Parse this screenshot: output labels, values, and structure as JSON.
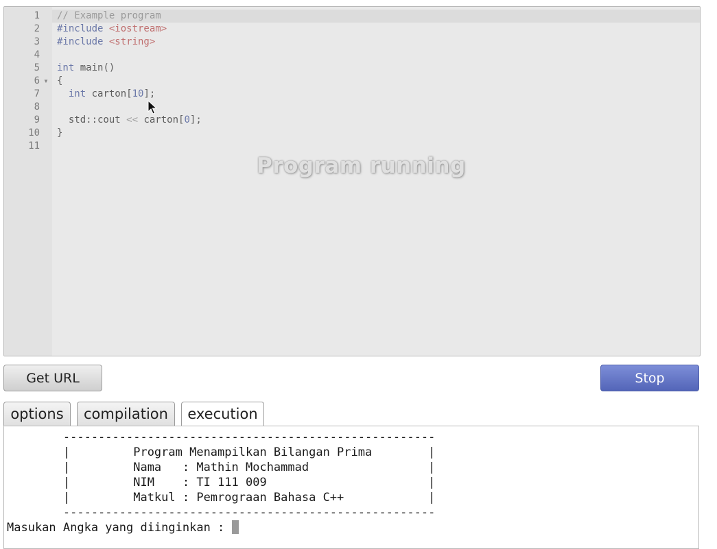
{
  "editor": {
    "line_numbers": [
      "1",
      "2",
      "3",
      "4",
      "5",
      "6",
      "7",
      "8",
      "9",
      "10",
      "11"
    ],
    "lines": [
      [
        {
          "t": "// Example program",
          "c": "comment"
        }
      ],
      [
        {
          "t": "#include ",
          "c": "meta"
        },
        {
          "t": "<iostream>",
          "c": "string"
        }
      ],
      [
        {
          "t": "#include ",
          "c": "meta"
        },
        {
          "t": "<string>",
          "c": "string"
        }
      ],
      [],
      [
        {
          "t": "int",
          "c": "keyword"
        },
        {
          "t": " main()",
          "c": "plain"
        }
      ],
      [
        {
          "t": "{",
          "c": "plain"
        }
      ],
      [
        {
          "t": "  ",
          "c": "plain"
        },
        {
          "t": "int",
          "c": "keyword"
        },
        {
          "t": " carton[",
          "c": "plain"
        },
        {
          "t": "10",
          "c": "number"
        },
        {
          "t": "];",
          "c": "plain"
        }
      ],
      [],
      [
        {
          "t": "  std::cout ",
          "c": "plain"
        },
        {
          "t": "<<",
          "c": "op"
        },
        {
          "t": " carton[",
          "c": "plain"
        },
        {
          "t": "0",
          "c": "number"
        },
        {
          "t": "];",
          "c": "plain"
        }
      ],
      [
        {
          "t": "}",
          "c": "plain"
        }
      ],
      []
    ],
    "overlay_text": "Program running",
    "fold_marker_line": 6
  },
  "buttons": {
    "get_url": "Get URL",
    "stop": "Stop"
  },
  "tabs": [
    "options",
    "compilation",
    "execution"
  ],
  "active_tab": "execution",
  "console": {
    "lines": [
      "        -----------------------------------------------------",
      "        |         Program Menampilkan Bilangan Prima        |",
      "        |         Nama   : Mathin Mochammad                 |",
      "        |         NIM    : TI 111 009                       |",
      "        |         Matkul : Pemrograan Bahasa C++            |",
      "        -----------------------------------------------------"
    ],
    "prompt": "Masukan Angka yang diinginkan : "
  },
  "colors": {
    "stop_button": "#5a6cc0",
    "editor_background": "#e9e9e9"
  }
}
